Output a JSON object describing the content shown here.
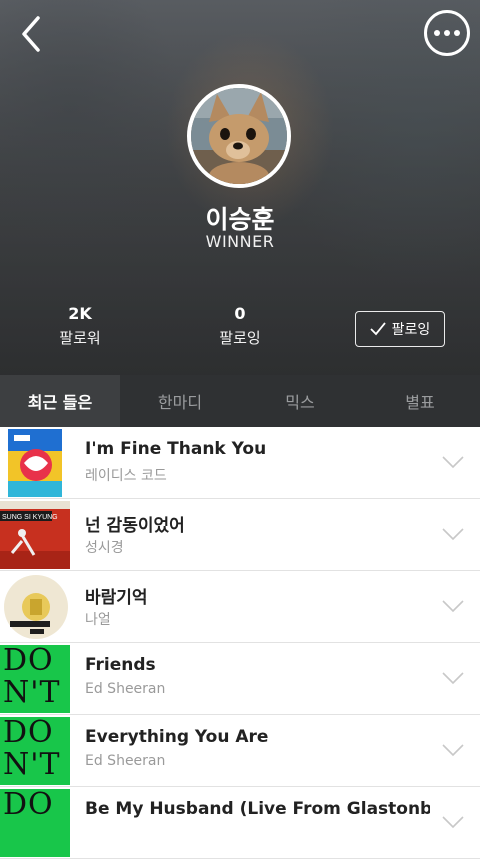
{
  "profile": {
    "name": "이승훈",
    "subtitle": "WINNER",
    "followers_count": "2K",
    "followers_label": "팔로워",
    "following_count": "0",
    "following_label": "팔로잉",
    "follow_button_label": "팔로잉"
  },
  "tabs": [
    {
      "label": "최근 들은",
      "active": true
    },
    {
      "label": "한마디",
      "active": false
    },
    {
      "label": "믹스",
      "active": false
    },
    {
      "label": "별표",
      "active": false
    }
  ],
  "tracks": [
    {
      "title": "I'm Fine Thank You",
      "artist": "레이디스 코드"
    },
    {
      "title": "넌 감동이었어",
      "artist": "성시경",
      "art_text": "SUNG SI KYUNG"
    },
    {
      "title": "바람기억",
      "artist": "나얼"
    },
    {
      "title": "Friends",
      "artist": "Ed Sheeran",
      "art_text": "DON'T"
    },
    {
      "title": "Everything You Are",
      "artist": "Ed Sheeran",
      "art_text": "DON'T"
    },
    {
      "title": "Be My Husband (Live From Glastonbury",
      "artist": "",
      "art_text": "DO"
    }
  ],
  "icons": {
    "back": "chevron-left-icon",
    "more": "more-icon",
    "check": "check-icon",
    "expand": "chevron-down-icon"
  },
  "colors": {
    "tab_bar": "#2f3133",
    "tab_active": "#3d3f41",
    "dont_green": "#18c64a"
  }
}
